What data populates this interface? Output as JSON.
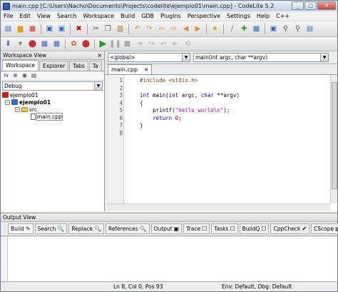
{
  "window": {
    "title": "main.cpp [C:\\Users\\Nacho\\Documents\\Projects\\codelite\\ejemplo01\\main.cpp] - CodeLite 5.2",
    "minimize": "_",
    "maximize": "□",
    "close": "✕"
  },
  "menu": [
    "File",
    "Edit",
    "View",
    "Search",
    "Workspace",
    "Build",
    "GDB",
    "Plugins",
    "Perspective",
    "Settings",
    "Help",
    "C++"
  ],
  "workspace": {
    "panel_title": "Workspace View",
    "close": "×",
    "tabs": [
      "Workspace",
      "Explorer",
      "Tabs",
      "Ta"
    ],
    "config": "Debug",
    "tree": {
      "workspace": "ejemplo01",
      "project": "ejemplo01",
      "folder": "src",
      "file": "main.cpp"
    }
  },
  "editor": {
    "scope_combo": "<global>",
    "function_combo": "main(int argc, char **argv)",
    "tab": "main.cpp",
    "tab_close": "×",
    "lines": [
      {
        "n": "1",
        "html": "<span class=\"pre\">#include &lt;stdio.h&gt;</span>"
      },
      {
        "n": "2",
        "html": ""
      },
      {
        "n": "3",
        "html": "<span class=\"kw\">int</span> main(<span class=\"kw\">int</span> argc, <span class=\"kw\">char</span> **argv)"
      },
      {
        "n": "4",
        "html": "{"
      },
      {
        "n": "5",
        "html": "    printf(<span class=\"str\">\"hello world\\n\"</span>);"
      },
      {
        "n": "6",
        "html": "    <span class=\"kw\">return</span> <span class=\"num\">0</span>;"
      },
      {
        "n": "7",
        "html": "}"
      },
      {
        "n": "8",
        "html": ""
      }
    ]
  },
  "output": {
    "panel_title": "Output View",
    "tabs": [
      {
        "label": "Build",
        "icon": "✎"
      },
      {
        "label": "Search",
        "icon": "🔍"
      },
      {
        "label": "Replace",
        "icon": "🔍"
      },
      {
        "label": "References",
        "icon": "🔍"
      },
      {
        "label": "Output",
        "icon": "▣"
      },
      {
        "label": "Trace",
        "icon": "☐"
      },
      {
        "label": "Tasks",
        "icon": "☐"
      },
      {
        "label": "BuildQ",
        "icon": "☐"
      },
      {
        "label": "CppCheck",
        "icon": "✔"
      },
      {
        "label": "CScope",
        "icon": "▤"
      }
    ]
  },
  "status": {
    "position": "Ln 8,  Col 0,  Pos 93",
    "env": "Env: Default, Dbg: Default"
  }
}
